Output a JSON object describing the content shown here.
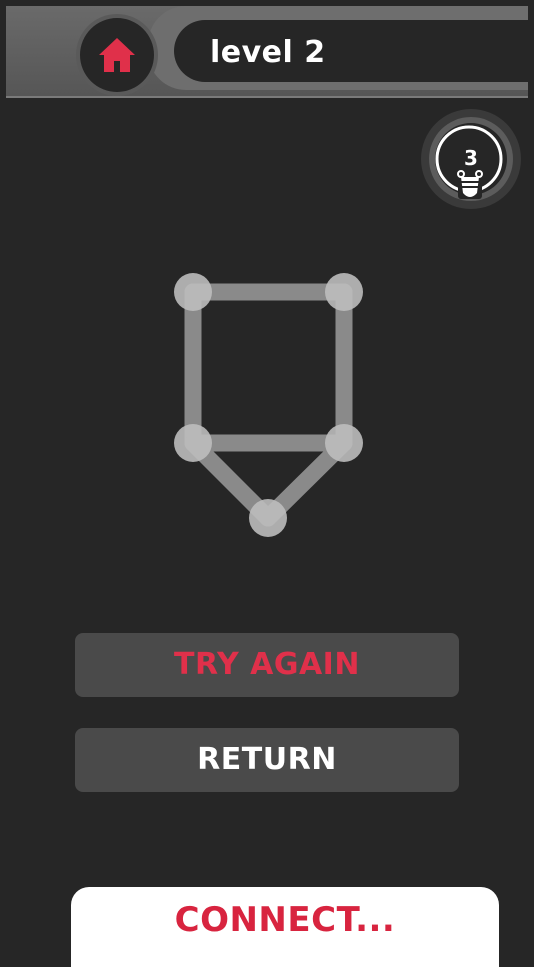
{
  "header": {
    "level_title": "level 2",
    "home_icon": "home-icon"
  },
  "hint": {
    "count": "3",
    "icon": "lightbulb-icon"
  },
  "buttons": {
    "try_again": "TRY AGAIN",
    "return": "RETURN"
  },
  "banner": {
    "text": "CONNECT..."
  },
  "colors": {
    "background": "#262626",
    "accent_red": "#e0304a",
    "button_gray": "#4a4a4a"
  }
}
